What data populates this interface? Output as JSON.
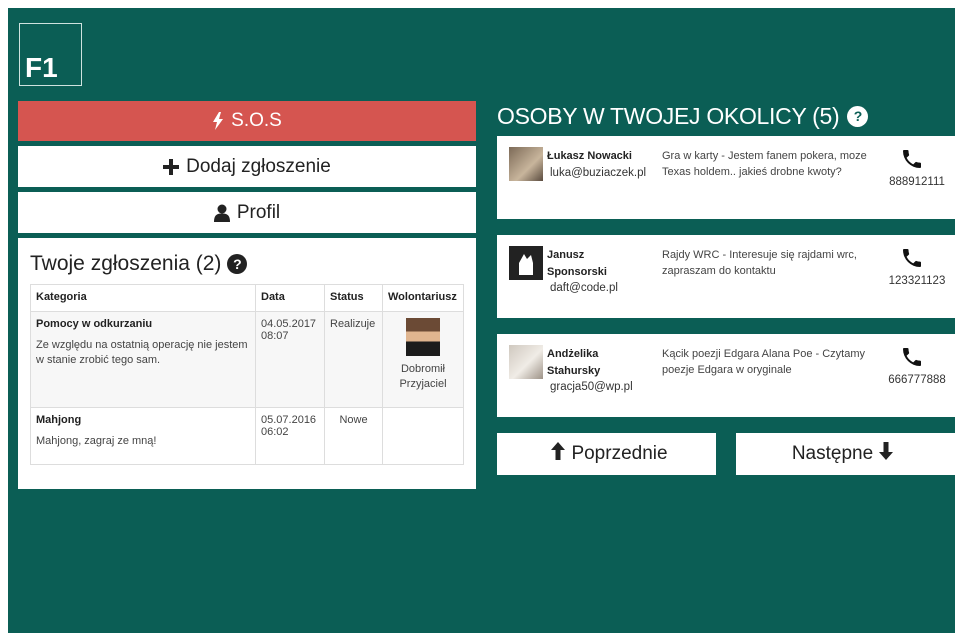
{
  "logo": {
    "text": "F1"
  },
  "menu": {
    "sos_label": "S.O.S",
    "add_label": "Dodaj zgłoszenie",
    "profile_label": "Profil"
  },
  "requests": {
    "title": "Twoje zgłoszenia (2)",
    "columns": [
      "Kategoria",
      "Data",
      "Status",
      "Wolontariusz"
    ],
    "rows": [
      {
        "title": "Pomocy w odkurzaniu",
        "description": "Ze względu na ostatnią operację nie jestem w stanie zrobić tego sam.",
        "date": "04.05.2017",
        "time": "08:07",
        "status": "Realizuje",
        "volunteer": "Dobromił Przyjaciel"
      },
      {
        "title": "Mahjong",
        "description": "Mahjong, zagraj ze mną!",
        "date": "05.07.2016",
        "time": "06:02",
        "status": "Nowe",
        "volunteer": ""
      }
    ]
  },
  "nearby": {
    "title": "OSOBY W TWOJEJ OKOLICY (5)",
    "people": [
      {
        "name": "Łukasz Nowacki",
        "email": "luka@buziaczek.pl",
        "description": "Gra w karty - Jestem fanem pokera, moze Texas holdem.. jakieś drobne kwoty?",
        "phone": "888912111"
      },
      {
        "name": "Janusz Sponsorski",
        "email": "daft@code.pl",
        "description": "Rajdy WRC - Interesuje się rajdami wrc, zapraszam do kontaktu",
        "phone": "123321123"
      },
      {
        "name": "Andżelika Stahursky",
        "email": "gracja50@wp.pl",
        "description": "Kącik poezji Edgara Alana Poe - Czytamy poezje Edgara w oryginale",
        "phone": "666777888"
      }
    ],
    "prev_label": "Poprzednie",
    "next_label": "Następne"
  },
  "colors": {
    "background": "#0b5e55",
    "sos": "#d55550"
  },
  "icons": [
    "bolt-icon",
    "plus-icon",
    "user-icon",
    "question-icon",
    "phone-icon",
    "arrow-up-icon",
    "arrow-down-icon"
  ]
}
